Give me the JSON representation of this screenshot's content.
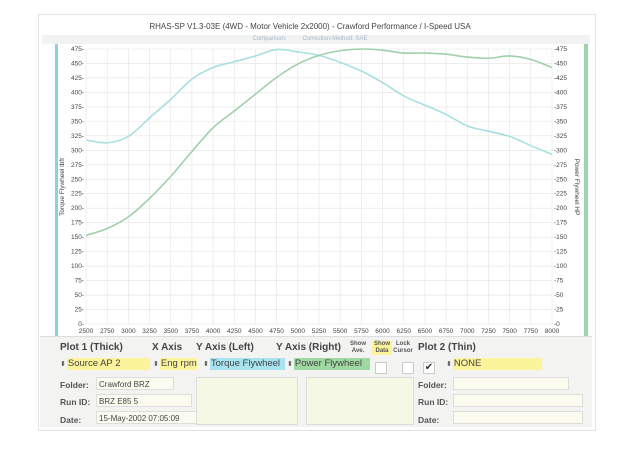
{
  "header": {
    "title": "RHAS-SP V1.3-03E  (4WD - Motor Vehicle 2x2000) - Crawford Performance / I-Speed USA",
    "comparison": "Comparison:",
    "correction": "Correction-Method: SAE"
  },
  "chart_data": {
    "type": "line",
    "x": [
      2500,
      2750,
      3000,
      3250,
      3500,
      3750,
      4000,
      4250,
      4500,
      4750,
      5000,
      5250,
      5500,
      5750,
      6000,
      6250,
      6500,
      6750,
      7000,
      7250,
      7500,
      7750,
      8000
    ],
    "series": [
      {
        "name": "Torque Flywheel lbft",
        "axis": "left",
        "color": "#a9dfe0",
        "values": [
          318,
          313,
          324,
          356,
          388,
          423,
          443,
          453,
          463,
          474,
          470,
          464,
          452,
          437,
          417,
          394,
          378,
          362,
          342,
          333,
          324,
          308,
          293
        ]
      },
      {
        "name": "Power Flywheel HP",
        "axis": "right",
        "color": "#9fd0aa",
        "values": [
          153,
          165,
          185,
          217,
          255,
          298,
          339,
          368,
          397,
          426,
          449,
          464,
          472,
          475,
          473,
          468,
          468,
          466,
          461,
          459,
          463,
          457,
          443
        ]
      }
    ],
    "xlabel": "",
    "ylabel_left": "Torque Flywheel lbft",
    "ylabel_right": "Power Flywheel HP",
    "xlim": [
      2500,
      8000
    ],
    "ylim": [
      0,
      475
    ],
    "xticks": [
      2500,
      2750,
      3000,
      3250,
      3500,
      3750,
      4000,
      4250,
      4500,
      4750,
      5000,
      5250,
      5500,
      5750,
      6000,
      6250,
      6500,
      6750,
      7000,
      7250,
      7500,
      7750,
      8000
    ],
    "yticks": [
      0,
      25,
      50,
      75,
      100,
      125,
      150,
      175,
      200,
      225,
      250,
      275,
      300,
      325,
      350,
      375,
      400,
      425,
      450,
      475
    ],
    "grid": true
  },
  "controls": {
    "plot1_label": "Plot 1 (Thick)",
    "xaxis_label": "X Axis",
    "yleft_label": "Y Axis (Left)",
    "yright_label": "Y Axis (Right)",
    "show_ave_label": "Show Ave.",
    "show_data_label": "Show Data",
    "lock_cursor_label": "Lock Cursor",
    "plot2_label": "Plot 2 (Thin)",
    "plot1_value": "Source AP 2",
    "xaxis_value": "Eng rpm",
    "yleft_value": "Torque Flywheel",
    "yright_value": "Power Flywheel",
    "plot2_value": "NONE",
    "show_ave": false,
    "show_data": false,
    "lock_cursor": true,
    "lock_mark": "✔",
    "spin_icon": "⬍",
    "colors": {
      "yellow": "#fbf49a",
      "cyan": "#a8e3f0",
      "green": "#9fd8a2"
    }
  },
  "plot1_info": {
    "folder_label": "Folder:",
    "folder": "Crawford BRZ",
    "runid_label": "Run ID:",
    "runid": "BRZ E85 5",
    "date_label": "Date:",
    "date": "15-May-2002  07:05:09"
  },
  "plot2_info": {
    "folder_label": "Folder:",
    "runid_label": "Run ID:",
    "date_label": "Date:"
  }
}
